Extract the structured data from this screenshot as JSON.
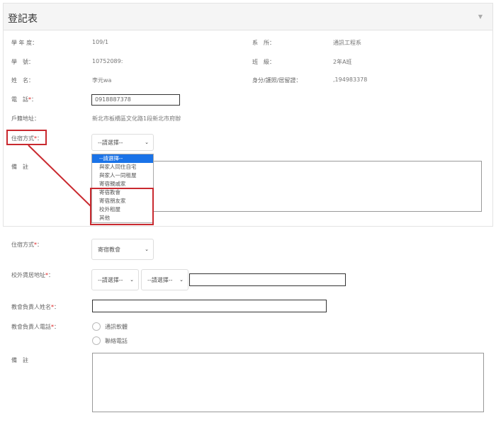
{
  "card": {
    "title": "登記表"
  },
  "info": {
    "year_label": "學 年 度：",
    "year_value": "109/1",
    "dept_label": "系　所：",
    "dept_value": "通訊工程系",
    "id_label": "學　號：",
    "id_value": "10752089:",
    "class_label": "班　級：",
    "class_value": "2年A班",
    "name_label": "姓　名：",
    "name_value": "李元wa",
    "identity_label": "身分/護照/居留證：",
    "identity_value": ",194983378",
    "phone_label": "電　話",
    "phone_value": "0918887378",
    "address_label": "戶籍地址：",
    "address_value": "新北市板橋區文化路1段新北市府辦",
    "residence_label": "住宿方式",
    "select_placeholder": "--請選擇--",
    "note_label": "備　註"
  },
  "dropdown": {
    "options": [
      "--請選擇--",
      "與家人同住自宅",
      "與家人一同租屋",
      "寄宿親戚家",
      "寄宿教會",
      "寄宿朋友家",
      "校外租屋",
      "其他"
    ]
  },
  "form": {
    "residence_label": "住宿方式",
    "residence_value": "寄宿教會",
    "address_label": "校外賃居地址",
    "select_placeholder": "--請選擇--",
    "church_name_label": "教會負責人姓名",
    "church_phone_label": "教會負責人電話",
    "phone_option_1": "通訊軟體",
    "phone_option_2": "聯絡電話",
    "note_label": "備　註"
  },
  "colors": {
    "highlight": "#c9292f",
    "selected_option": "#1a73e8"
  },
  "icons": {
    "collapse": "caret-down-icon",
    "select": "chevron-down-icon"
  }
}
